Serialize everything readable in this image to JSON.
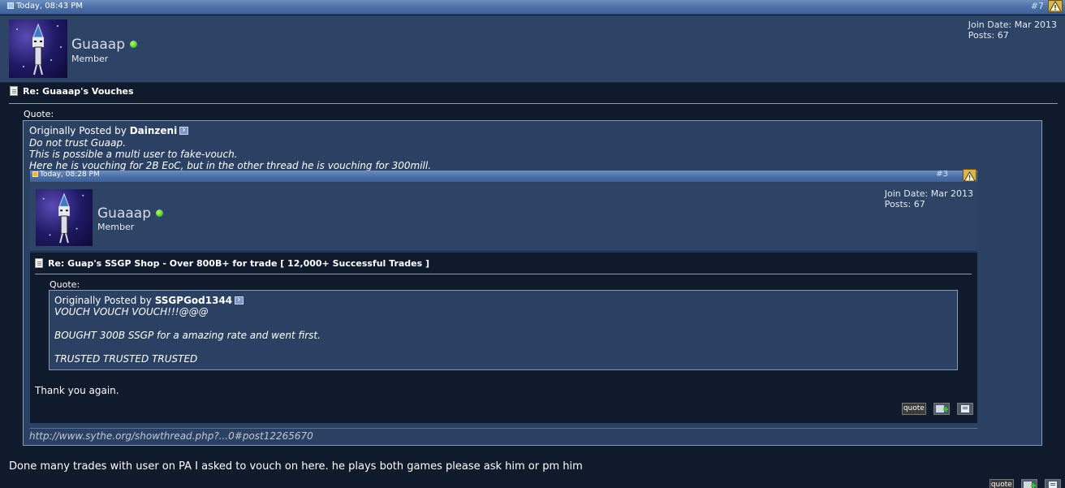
{
  "post": {
    "date": "Today, 08:43 PM",
    "number": "#7",
    "user": {
      "name": "Guaaap",
      "title": "Member",
      "join_date": "Join Date: Mar 2013",
      "posts": "Posts: 67"
    },
    "title": "Re: Guaaap's Vouches",
    "message": "Done many trades with user on PA I asked to vouch on here. he plays both games please ask him or pm him",
    "buttons": {
      "quote": "quote"
    }
  },
  "quote": {
    "label": "Quote:",
    "originally_posted_by": "Originally Posted by",
    "author": "Dainzeni",
    "lines": [
      "Do not trust Guaap.",
      "This is possible a multi user to fake-vouch.",
      "Here he is vouching for 2B EoC, but in the other thread he is vouching for 300mill."
    ],
    "link": "http://www.sythe.org/showthread.php?...0#post12265670"
  },
  "inner_post": {
    "date": "Today, 08:28 PM",
    "number": "#3",
    "user": {
      "name": "Guaaap",
      "title": "Member",
      "join_date": "Join Date: Mar 2013",
      "posts": "Posts: 67"
    },
    "title": "Re: Guap's SSGP Shop - Over 800B+ for trade [ 12,000+ Successful Trades ]",
    "quote": {
      "label": "Quote:",
      "originally_posted_by": "Originally Posted by",
      "author": "SSGPGod1344",
      "lines": [
        "VOUCH VOUCH VOUCH!!!@@@",
        "BOUGHT 300B SSGP for a amazing rate and went first.",
        "TRUSTED TRUSTED TRUSTED"
      ]
    },
    "message": "Thank you again.",
    "buttons": {
      "quote": "quote"
    }
  },
  "icons": [
    "post-date-icon",
    "warning-icon",
    "online-status-icon",
    "document-icon",
    "view-post-icon",
    "quote-button",
    "add-reply-icon",
    "edit-icon"
  ],
  "colors": {
    "header": "#4a6ea6",
    "userbar": "#2e4466",
    "background": "#0f1a2c",
    "quote_bg": "#2b4163",
    "online": "#22a30a"
  }
}
